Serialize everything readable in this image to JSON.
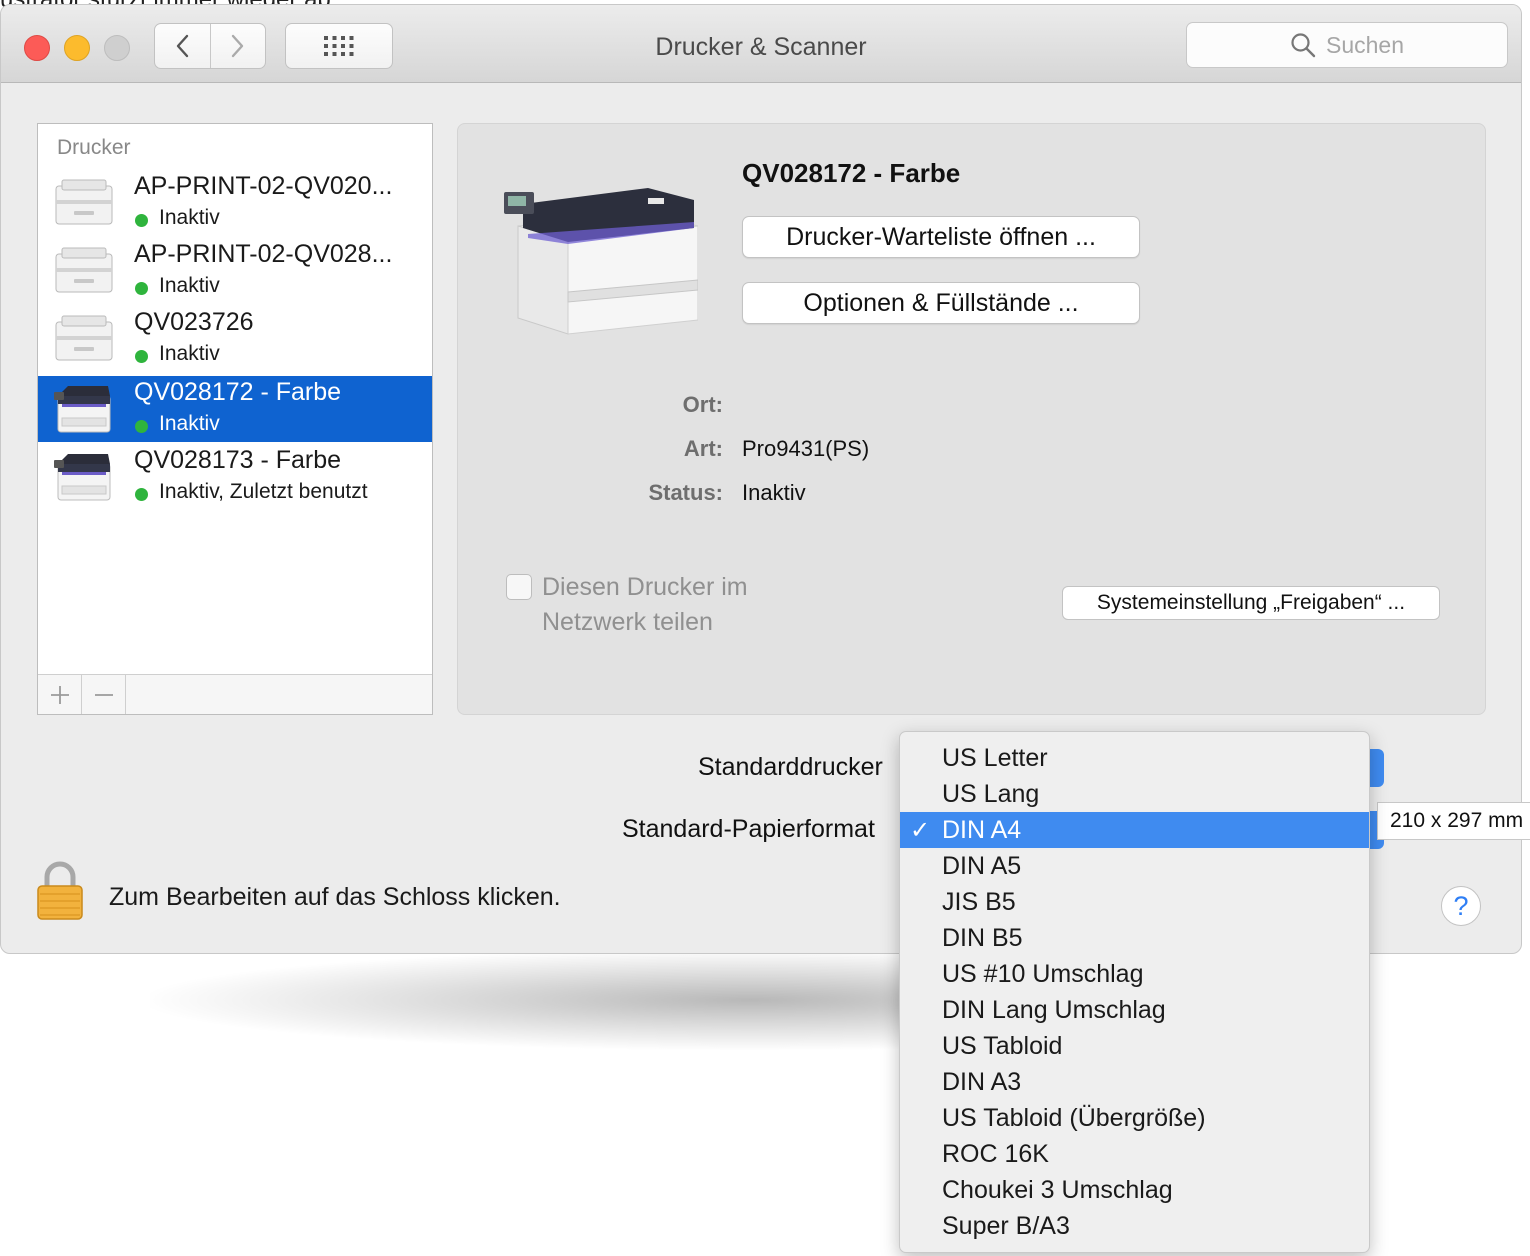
{
  "background": {
    "top_text": "ustrator stürzt immer wieder ab"
  },
  "window": {
    "title": "Drucker & Scanner",
    "search_placeholder": "Suchen",
    "icons": [
      "back-chevron",
      "forward-chevron",
      "grid"
    ]
  },
  "printers": {
    "heading": "Drucker",
    "items": [
      {
        "name": "AP-PRINT-02-QV020...",
        "status": "Inaktiv",
        "selected": false,
        "icon": "printer-gray"
      },
      {
        "name": "AP-PRINT-02-QV028...",
        "status": "Inaktiv",
        "selected": false,
        "icon": "printer-gray"
      },
      {
        "name": "QV023726",
        "status": "Inaktiv",
        "selected": false,
        "icon": "printer-gray"
      },
      {
        "name": "QV028172 - Farbe",
        "status": "Inaktiv",
        "selected": true,
        "icon": "printer-color"
      },
      {
        "name": "QV028173 - Farbe",
        "status": "Inaktiv, Zuletzt benutzt",
        "selected": false,
        "icon": "printer-color"
      }
    ],
    "add_label": "+",
    "remove_label": "—"
  },
  "detail": {
    "printer_name": "QV028172 - Farbe",
    "queue_button": "Drucker-Warteliste öffnen ...",
    "options_button": "Optionen & Füllstände ...",
    "location_label": "Ort:",
    "location_value": "",
    "kind_label": "Art:",
    "kind_value": "Pro9431(PS)",
    "status_label": "Status:",
    "status_value": "Inaktiv",
    "share_label": "Diesen Drucker im Netzwerk teilen",
    "sharing_button": "Systemeinstellung „Freigaben“ ..."
  },
  "defaults": {
    "default_printer_label": "Standarddrucker",
    "paper_size_label": "Standard-Papierformat",
    "paper_size_tooltip": "210 x 297 mm"
  },
  "paper_menu": {
    "selected_index": 2,
    "check": "✓",
    "items": [
      "US Letter",
      "US Lang",
      "DIN A4",
      "DIN A5",
      "JIS B5",
      "DIN B5",
      "US #10 Umschlag",
      "DIN Lang Umschlag",
      "US Tabloid",
      "DIN A3",
      "US Tabloid (Übergröße)",
      "ROC 16K",
      "Choukei 3 Umschlag",
      "Super B/A3"
    ]
  },
  "footer": {
    "lock_text": "Zum Bearbeiten auf das Schloss klicken.",
    "help_label": "?"
  },
  "colors": {
    "selection": "#0f63d0",
    "menu_highlight": "#3f8bf0",
    "status_dot": "#2fb43d",
    "close": "#fc5b57",
    "minimize": "#fcbb2d"
  }
}
